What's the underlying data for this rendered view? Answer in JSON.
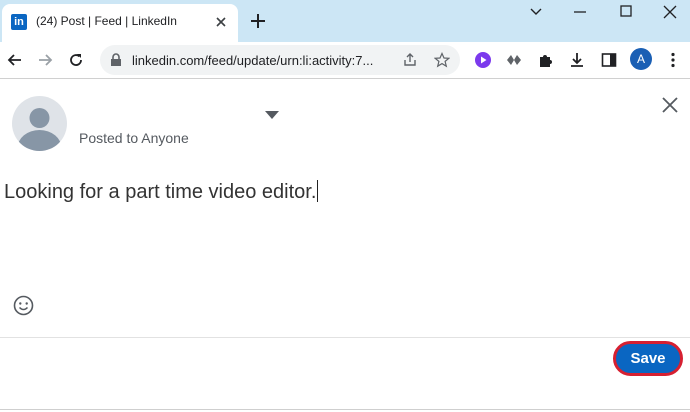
{
  "browser": {
    "tab_title": "(24) Post | Feed | LinkedIn",
    "favicon_text": "in",
    "url": "linkedin.com/feed/update/urn:li:activity:7...",
    "profile_initial": "A",
    "icons": [
      "back-arrow-icon",
      "forward-arrow-icon",
      "reload-icon",
      "lock-icon",
      "share-icon",
      "star-icon",
      "play-extension-icon",
      "puzzle-extension-icon",
      "extensions-icon",
      "download-icon",
      "side-panel-icon"
    ]
  },
  "post": {
    "audience": "Posted to Anyone",
    "text": "Looking for a part time video editor."
  },
  "actions": {
    "save_label": "Save"
  },
  "colors": {
    "titlebar": "#cce6f5",
    "linkedin_blue": "#0a66c2",
    "save_highlight": "#d62031"
  }
}
